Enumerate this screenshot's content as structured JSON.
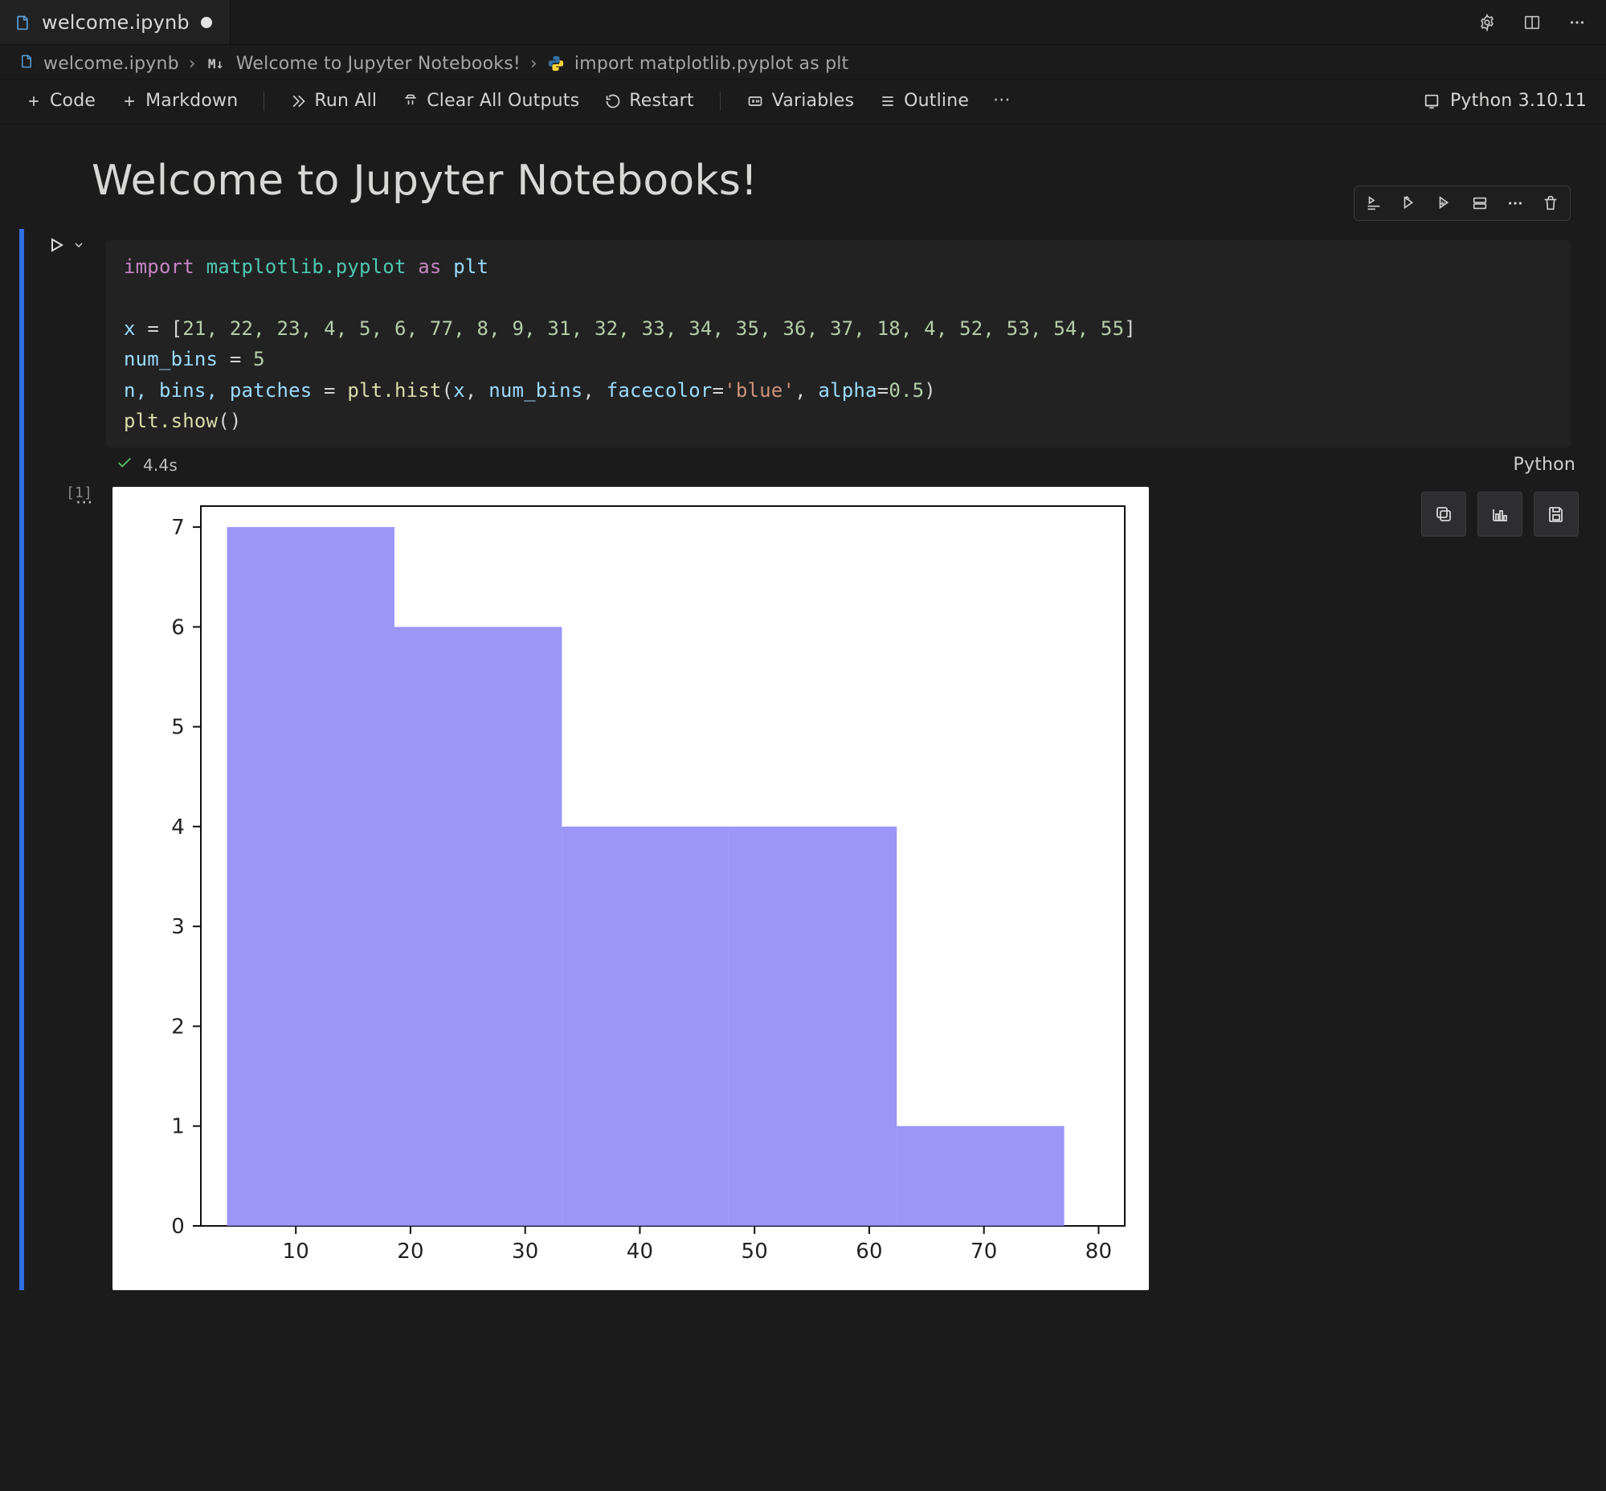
{
  "tab": {
    "filename": "welcome.ipynb",
    "dirty": true
  },
  "breadcrumb": {
    "file": "welcome.ipynb",
    "sectionKind": "M↓",
    "section": "Welcome to Jupyter Notebooks!",
    "langIcon": "python",
    "codeHint": "import matplotlib.pyplot as plt"
  },
  "toolbar": {
    "code": "Code",
    "markdown": "Markdown",
    "runAll": "Run All",
    "clearAll": "Clear All Outputs",
    "restart": "Restart",
    "variables": "Variables",
    "outline": "Outline"
  },
  "kernel": {
    "label": "Python 3.10.11"
  },
  "header": {
    "title": "Welcome to Jupyter Notebooks!"
  },
  "cell": {
    "executionCount": "[1]",
    "status": {
      "ok": true,
      "duration": "4.4s",
      "lang": "Python"
    },
    "code": {
      "line1_kw": "import",
      "line1_mod": "matplotlib.pyplot",
      "line1_as": "as",
      "line1_alias": "plt",
      "line3_lhs": "x",
      "line3_eq": "=",
      "line3_list_open": "[",
      "line3_list": "21, 22, 23, 4, 5, 6, 77, 8, 9, 31, 32, 33, 34, 35, 36, 37, 18, 4, 52, 53, 54, 55",
      "line3_list_close": "]",
      "line4_lhs": "num_bins",
      "line4_eq": "=",
      "line4_val": "5",
      "line5_lhs": "n, bins, patches",
      "line5_eq": "=",
      "line5_call1": "plt.hist",
      "line5_args_open": "(",
      "line5_arg_x": "x",
      "line5_comma1": ", ",
      "line5_arg_bins": "num_bins",
      "line5_comma2": ", ",
      "line5_kwarg1_k": "facecolor",
      "line5_kwarg1_eq": "=",
      "line5_kwarg1_v": "'blue'",
      "line5_comma3": ", ",
      "line5_kwarg2_k": "alpha",
      "line5_kwarg2_eq": "=",
      "line5_kwarg2_v": "0.5",
      "line5_args_close": ")",
      "line6_call": "plt.show",
      "line6_paren": "()"
    },
    "actions": [
      "run-by-line",
      "move-up",
      "move-down",
      "split-cell",
      "more",
      "delete"
    ]
  },
  "outputActions": [
    "copy-output",
    "open-in-plot-viewer",
    "save-image"
  ],
  "chart_data": {
    "type": "bar",
    "title": "",
    "xlabel": "",
    "ylabel": "",
    "xlim": [
      4,
      80
    ],
    "ylim": [
      0,
      7
    ],
    "xticks": [
      10,
      20,
      30,
      40,
      50,
      60,
      70,
      80
    ],
    "yticks": [
      0,
      1,
      2,
      3,
      4,
      5,
      6,
      7
    ],
    "bins": [
      {
        "start": 4.0,
        "end": 18.6,
        "count": 7
      },
      {
        "start": 18.6,
        "end": 33.2,
        "count": 6
      },
      {
        "start": 33.2,
        "end": 47.8,
        "count": 4
      },
      {
        "start": 47.8,
        "end": 62.4,
        "count": 4
      },
      {
        "start": 62.4,
        "end": 77.0,
        "count": 1
      }
    ],
    "facecolor": "#8a84f7",
    "alpha": 0.85
  }
}
